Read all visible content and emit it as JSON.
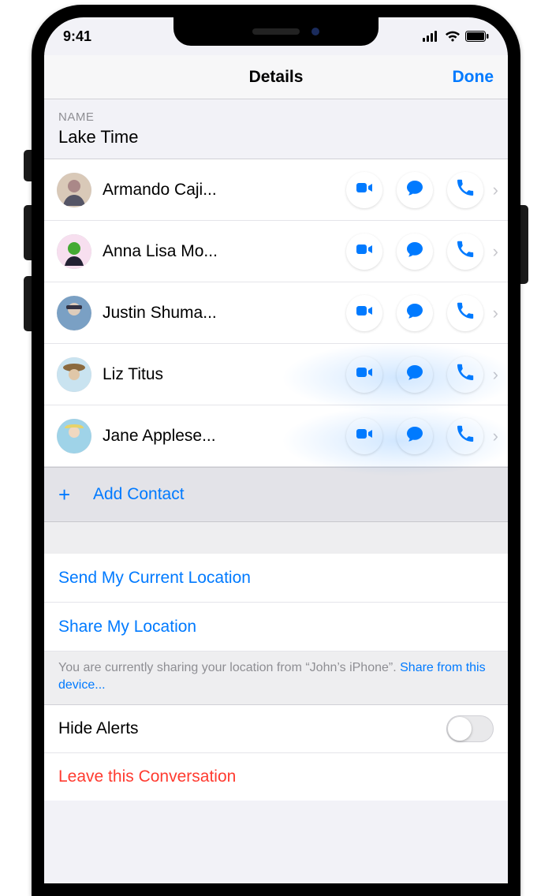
{
  "status": {
    "time": "9:41"
  },
  "nav": {
    "title": "Details",
    "done": "Done"
  },
  "section_name_header": "NAME",
  "group_name": "Lake Time",
  "contacts": [
    {
      "name": "Armando Caji..."
    },
    {
      "name": "Anna Lisa Mo..."
    },
    {
      "name": "Justin Shuma..."
    },
    {
      "name": "Liz Titus"
    },
    {
      "name": "Jane Applese..."
    }
  ],
  "add_contact": "Add Contact",
  "send_location": "Send My Current Location",
  "share_location": "Share My Location",
  "footnote_a": "You are currently sharing your location from “John’s iPhone”. ",
  "footnote_link": "Share from this device...",
  "hide_alerts": "Hide Alerts",
  "leave_conversation": "Leave this Conversation"
}
